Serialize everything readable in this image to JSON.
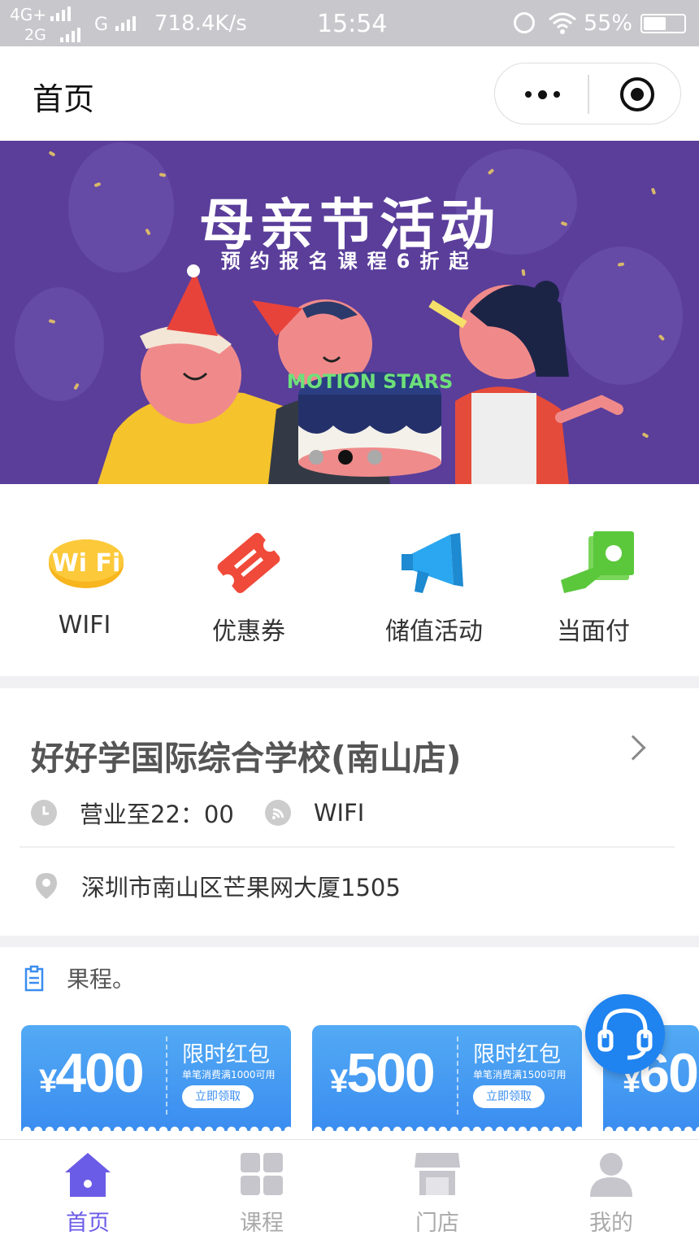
{
  "status_bar": {
    "network1": "4G+",
    "network2": "2G",
    "network3": "G",
    "speed": "718.4K/s",
    "time": "15:54",
    "battery": "55%"
  },
  "nav": {
    "title": "首页"
  },
  "banner": {
    "title": "母亲节活动",
    "subtitle": "预约报名课程6折起",
    "cake_text": "MOTION STARS"
  },
  "quick_entries": [
    {
      "label": "WIFI",
      "icon": "wifi-icon",
      "color": "#f7b51e"
    },
    {
      "label": "优惠券",
      "icon": "coupon-ticket-icon",
      "color": "#f04a3a"
    },
    {
      "label": "储值活动",
      "icon": "megaphone-icon",
      "color": "#2aa7f0"
    },
    {
      "label": "当面付",
      "icon": "hand-money-icon",
      "color": "#5bc83c"
    }
  ],
  "store": {
    "name": "好好学国际综合学校(南山店)",
    "hours": "营业至22：00",
    "wifi": "WIFI",
    "address": "深圳市南山区芒果网大厦1505"
  },
  "notice": {
    "text": "果程。"
  },
  "coupons": [
    {
      "currency": "¥",
      "amount": "400",
      "title": "限时红包",
      "desc": "单笔消费满1000可用",
      "button": "立即领取"
    },
    {
      "currency": "¥",
      "amount": "500",
      "title": "限时红包",
      "desc": "单笔消费满1500可用",
      "button": "立即领取"
    },
    {
      "currency": "¥",
      "amount": "60"
    }
  ],
  "tabs": [
    {
      "label": "首页",
      "icon": "home-icon",
      "active": true
    },
    {
      "label": "课程",
      "icon": "grid-icon",
      "active": false
    },
    {
      "label": "门店",
      "icon": "store-icon",
      "active": false
    },
    {
      "label": "我的",
      "icon": "user-icon",
      "active": false
    }
  ],
  "colors": {
    "accent": "#6b5ce7",
    "coupon_blue": "#3a8df0",
    "banner_purple": "#5a3e9a",
    "fab_blue": "#1f83f0"
  }
}
